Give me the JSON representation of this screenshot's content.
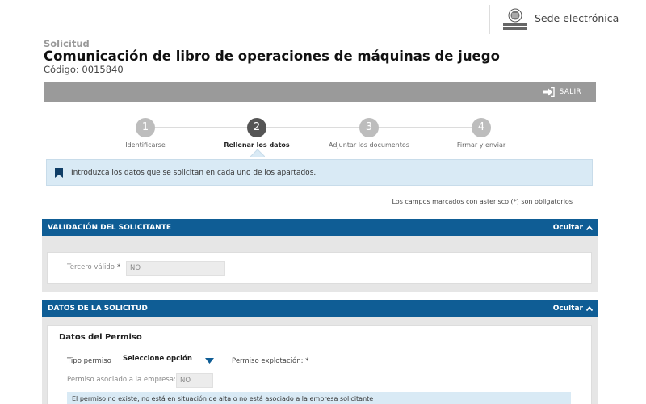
{
  "header": {
    "brand_text": "Sede electrónica",
    "seal_caption": "EUSKO JAURLARITZA GOBIERNO VASCO"
  },
  "page": {
    "pre_title": "Solicitud",
    "title": "Comunicación de libro de operaciones de máquinas de juego",
    "code": "Código: 0015840"
  },
  "toolbar": {
    "exit_label": "SALIR",
    "exit_icon": "sign-out-icon"
  },
  "stepper": {
    "steps": [
      {
        "number": "1",
        "label": "Identificarse"
      },
      {
        "number": "2",
        "label": "Rellenar los datos"
      },
      {
        "number": "3",
        "label": "Adjuntar los documentos"
      },
      {
        "number": "4",
        "label": "Firmar y enviar"
      }
    ],
    "active_step": 2
  },
  "info": {
    "icon": "bookmark-icon",
    "text": "Introduzca los datos que se solicitan en cada uno de los apartados."
  },
  "mandatory_note": "Los campos marcados con asterisco (*) son obligatorios",
  "sections": {
    "applicant": {
      "title": "VALIDACIÓN DEL SOLICITANTE",
      "toggle_label": "Ocultar",
      "fields": {
        "tercero_label": "Tercero válido",
        "tercero_required": "*",
        "tercero_value": "NO"
      }
    },
    "request": {
      "title": "DATOS DE LA SOLICITUD",
      "toggle_label": "Ocultar",
      "subsection_title": "Datos del Permiso",
      "fields": {
        "tipo_permiso_label": "Tipo permiso",
        "tipo_permiso_value": "Seleccione opción",
        "permiso_explotacion_label": "Permiso explotación:",
        "permiso_explotacion_required": "*",
        "permiso_asociado_label": "Permiso asociado a la empresa:",
        "permiso_asociado_value": "NO"
      },
      "alert": "El permiso no existe, no está en situación de alta o no está asociado a la empresa solicitante"
    }
  },
  "colors": {
    "section_header": "#0f5d95",
    "toolbar": "#9a9a9a",
    "info_bg": "#d9eaf5",
    "step_active": "#555555",
    "step_inactive": "#bdbdbd",
    "select_arrow": "#0f5d95"
  }
}
